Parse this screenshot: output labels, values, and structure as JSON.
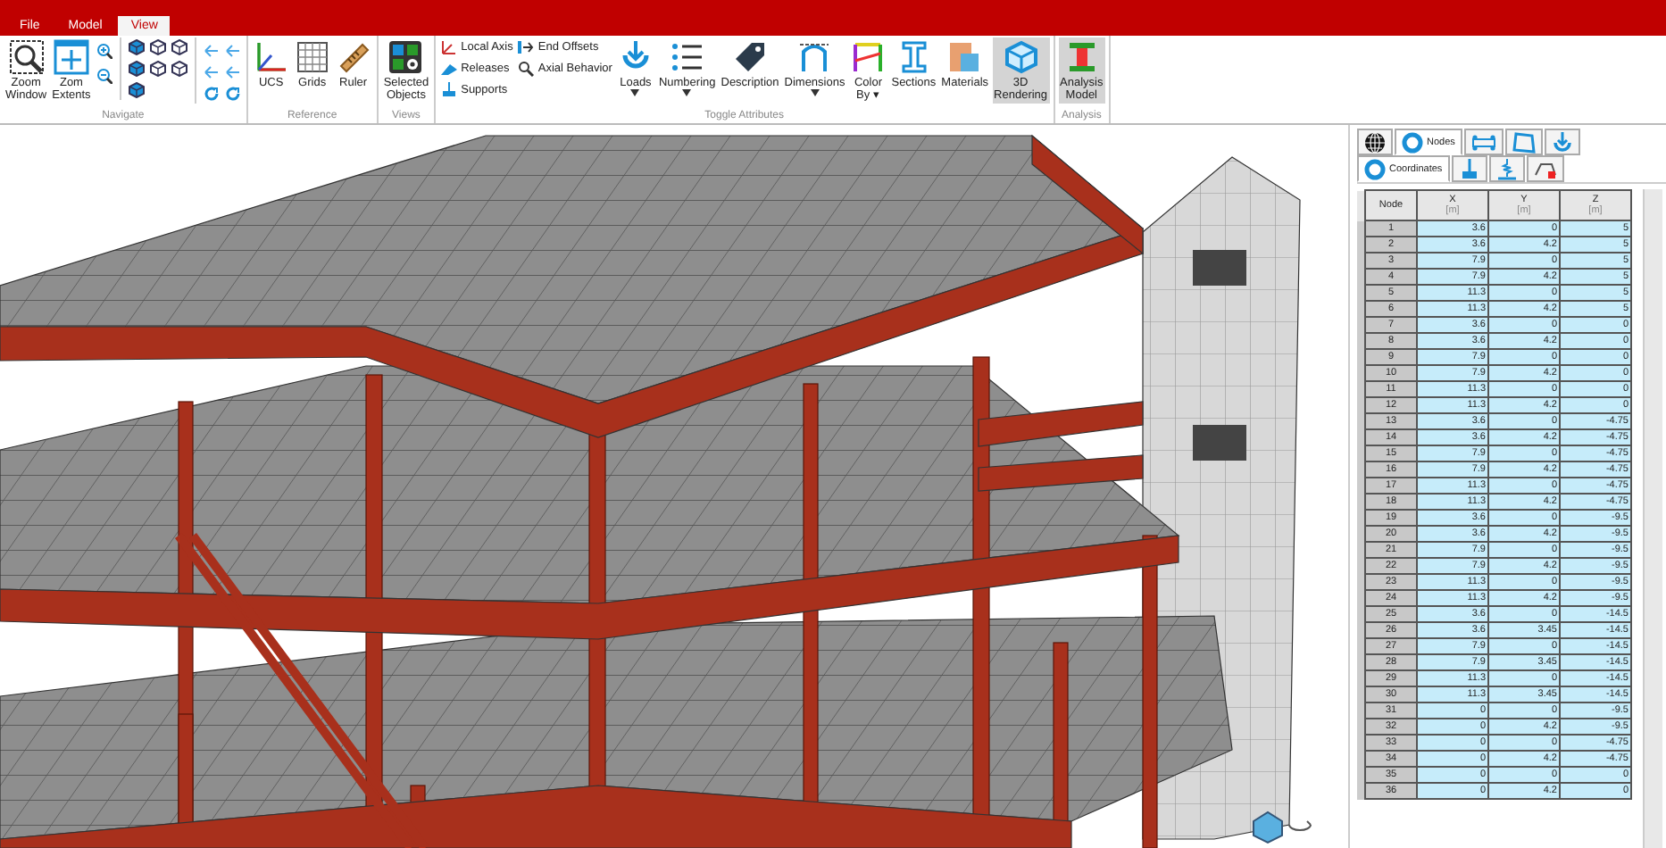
{
  "ribbon": {
    "tabs": [
      {
        "label": "File",
        "selected": false
      },
      {
        "label": "Model",
        "selected": false
      },
      {
        "label": "View",
        "selected": true
      }
    ],
    "groups": [
      {
        "label": "Navigate",
        "items": [
          {
            "kind": "large",
            "lines": [
              "Zoom",
              "Window"
            ],
            "pressed": false
          },
          {
            "kind": "large",
            "lines": [
              "Zom",
              "Extents"
            ],
            "pressed": false
          },
          {
            "kind": "zoompair"
          },
          {
            "kind": "cubes"
          },
          {
            "kind": "arrows"
          }
        ]
      },
      {
        "label": "Reference",
        "items": [
          {
            "kind": "large",
            "lines": [
              "UCS"
            ],
            "pressed": false
          },
          {
            "kind": "large",
            "lines": [
              "Grids"
            ],
            "pressed": false
          },
          {
            "kind": "large",
            "lines": [
              "Ruler"
            ],
            "pressed": false
          }
        ]
      },
      {
        "label": "Views",
        "items": [
          {
            "kind": "large",
            "lines": [
              "Selected",
              "Objects"
            ],
            "pressed": false
          }
        ]
      },
      {
        "label": "Toggle Attributes",
        "items": [
          {
            "kind": "column",
            "items": [
              {
                "label": "Local Axis"
              },
              {
                "label": "Releases"
              },
              {
                "label": "Supports"
              }
            ]
          },
          {
            "kind": "column",
            "items": [
              {
                "label": "End Offsets"
              },
              {
                "label": "Axial Behavior"
              }
            ]
          },
          {
            "kind": "large",
            "lines": [
              "Loads"
            ],
            "dropdown": true,
            "pressed": false
          },
          {
            "kind": "large",
            "lines": [
              "Numbering"
            ],
            "dropdown": true,
            "pressed": false
          },
          {
            "kind": "large",
            "lines": [
              "Description"
            ],
            "pressed": false
          },
          {
            "kind": "large",
            "lines": [
              "Dimensions"
            ],
            "dropdown": true,
            "pressed": false
          },
          {
            "kind": "large",
            "lines": [
              "Color",
              "By ▾"
            ],
            "pressed": false
          },
          {
            "kind": "large",
            "lines": [
              "Sections"
            ],
            "pressed": false
          },
          {
            "kind": "large",
            "lines": [
              "Materials"
            ],
            "pressed": false
          },
          {
            "kind": "large",
            "lines": [
              "3D",
              "Rendering"
            ],
            "pressed": true
          }
        ]
      },
      {
        "label": "Analysis",
        "items": [
          {
            "kind": "large",
            "lines": [
              "Analysis",
              "Model"
            ],
            "pressed": true
          }
        ]
      }
    ]
  },
  "panel": {
    "tabs": [
      {
        "kind": "globe",
        "selected": false
      },
      {
        "kind": "nodes",
        "label": "Nodes",
        "selected": true
      },
      {
        "kind": "beams",
        "selected": false
      },
      {
        "kind": "plates",
        "selected": false
      },
      {
        "kind": "loads",
        "selected": false
      }
    ],
    "subtabs": [
      {
        "kind": "coords",
        "label": "Coordinates",
        "selected": true
      },
      {
        "kind": "support",
        "selected": false
      },
      {
        "kind": "spring",
        "selected": false
      },
      {
        "kind": "release",
        "selected": false
      }
    ],
    "table": {
      "columns": [
        {
          "label": "Node"
        },
        {
          "label": "X",
          "unit": "[m]"
        },
        {
          "label": "Y",
          "unit": "[m]"
        },
        {
          "label": "Z",
          "unit": "[m]"
        }
      ],
      "rows": [
        [
          "1",
          "3.6",
          "0",
          "5"
        ],
        [
          "2",
          "3.6",
          "4.2",
          "5"
        ],
        [
          "3",
          "7.9",
          "0",
          "5"
        ],
        [
          "4",
          "7.9",
          "4.2",
          "5"
        ],
        [
          "5",
          "11.3",
          "0",
          "5"
        ],
        [
          "6",
          "11.3",
          "4.2",
          "5"
        ],
        [
          "7",
          "3.6",
          "0",
          "0"
        ],
        [
          "8",
          "3.6",
          "4.2",
          "0"
        ],
        [
          "9",
          "7.9",
          "0",
          "0"
        ],
        [
          "10",
          "7.9",
          "4.2",
          "0"
        ],
        [
          "11",
          "11.3",
          "0",
          "0"
        ],
        [
          "12",
          "11.3",
          "4.2",
          "0"
        ],
        [
          "13",
          "3.6",
          "0",
          "-4.75"
        ],
        [
          "14",
          "3.6",
          "4.2",
          "-4.75"
        ],
        [
          "15",
          "7.9",
          "0",
          "-4.75"
        ],
        [
          "16",
          "7.9",
          "4.2",
          "-4.75"
        ],
        [
          "17",
          "11.3",
          "0",
          "-4.75"
        ],
        [
          "18",
          "11.3",
          "4.2",
          "-4.75"
        ],
        [
          "19",
          "3.6",
          "0",
          "-9.5"
        ],
        [
          "20",
          "3.6",
          "4.2",
          "-9.5"
        ],
        [
          "21",
          "7.9",
          "0",
          "-9.5"
        ],
        [
          "22",
          "7.9",
          "4.2",
          "-9.5"
        ],
        [
          "23",
          "11.3",
          "0",
          "-9.5"
        ],
        [
          "24",
          "11.3",
          "4.2",
          "-9.5"
        ],
        [
          "25",
          "3.6",
          "0",
          "-14.5"
        ],
        [
          "26",
          "3.6",
          "3.45",
          "-14.5"
        ],
        [
          "27",
          "7.9",
          "0",
          "-14.5"
        ],
        [
          "28",
          "7.9",
          "3.45",
          "-14.5"
        ],
        [
          "29",
          "11.3",
          "0",
          "-14.5"
        ],
        [
          "30",
          "11.3",
          "3.45",
          "-14.5"
        ],
        [
          "31",
          "0",
          "0",
          "-9.5"
        ],
        [
          "32",
          "0",
          "4.2",
          "-9.5"
        ],
        [
          "33",
          "0",
          "0",
          "-4.75"
        ],
        [
          "34",
          "0",
          "4.2",
          "-4.75"
        ],
        [
          "35",
          "0",
          "0",
          "0"
        ],
        [
          "36",
          "0",
          "4.2",
          "0"
        ]
      ]
    }
  }
}
